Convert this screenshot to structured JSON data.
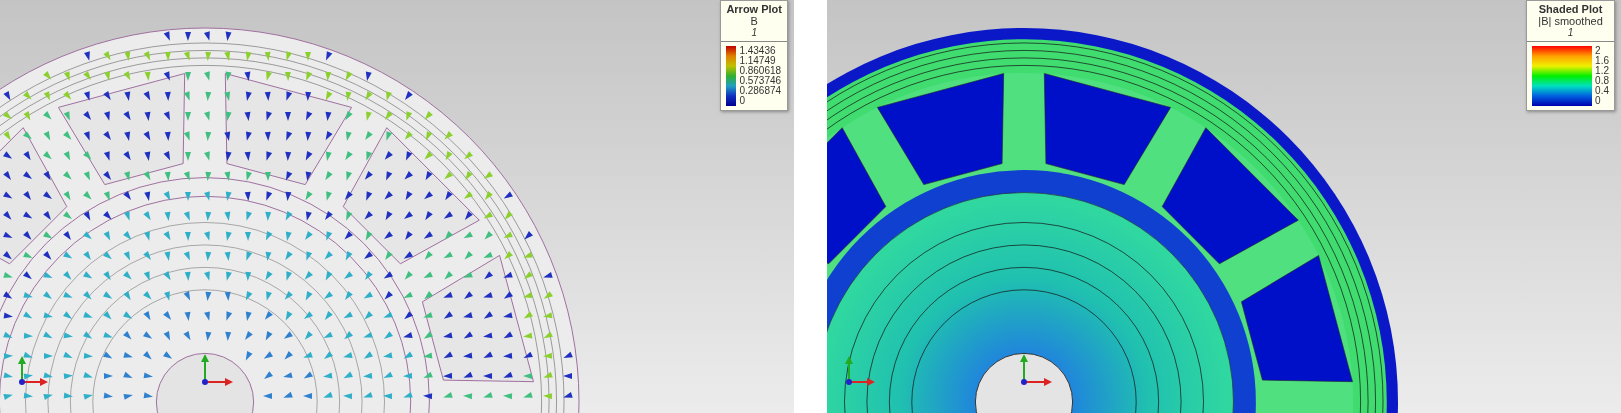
{
  "panels": [
    {
      "kind": "arrow",
      "legend": {
        "title": "Arrow Plot",
        "quantity": "B",
        "subtitle": "1",
        "ticks": [
          "1.43436",
          "1.14749",
          "0.860618",
          "0.573746",
          "0.286874",
          "0"
        ]
      }
    },
    {
      "kind": "shaded",
      "legend": {
        "title": "Shaded Plot",
        "quantity": "|B| smoothed",
        "subtitle": "1",
        "ticks": [
          "2",
          "1.6",
          "1.2",
          "0.8",
          "0.4",
          "0"
        ]
      }
    }
  ]
}
